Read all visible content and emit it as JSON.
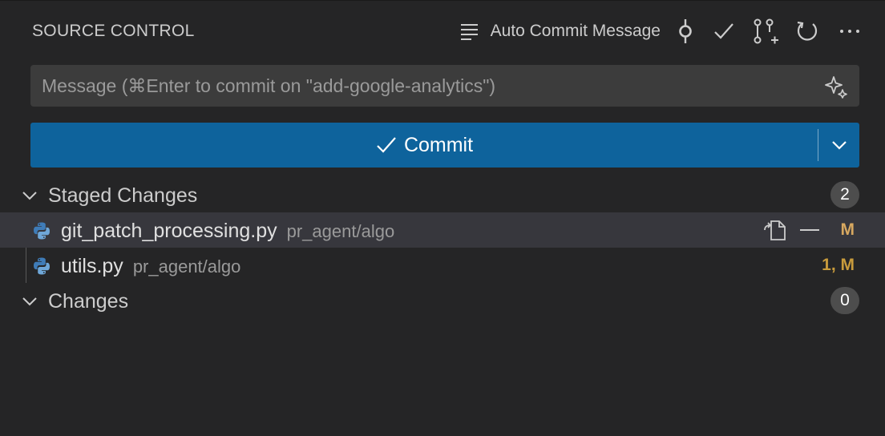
{
  "header": {
    "title": "SOURCE CONTROL",
    "auto_commit_label": "Auto Commit Message",
    "icons": [
      "list-icon",
      "commit-graph-icon",
      "checkmark-icon",
      "pull-request-icon",
      "refresh-icon",
      "more-icon"
    ]
  },
  "message_input": {
    "value": "",
    "placeholder": "Message (⌘Enter to commit on \"add-google-analytics\")",
    "icon": "sparkle-icon"
  },
  "commit_button": {
    "label": "Commit",
    "icon": "checkmark-icon",
    "dropdown_icon": "chevron-down-icon",
    "color": "#0e639c"
  },
  "groups": {
    "staged": {
      "label": "Staged Changes",
      "count": "2",
      "files": [
        {
          "name": "git_patch_processing.py",
          "dir": "pr_agent/algo",
          "status": "M",
          "icon": "python-icon"
        },
        {
          "name": "utils.py",
          "dir": "pr_agent/algo",
          "status": "1, M",
          "icon": "python-icon"
        }
      ]
    },
    "changes": {
      "label": "Changes",
      "count": "0"
    }
  },
  "colors": {
    "background": "#252526",
    "selected_row": "#37373d",
    "status_modified": "#d7a860"
  }
}
